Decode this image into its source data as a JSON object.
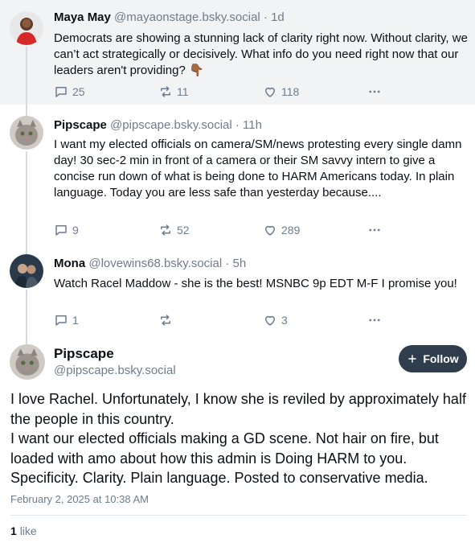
{
  "posts": [
    {
      "name": "Maya May",
      "handle": "@mayaonstage.bsky.social · 1d",
      "text": "Democrats are showing a stunning lack of clarity right now. Without clarity, we can’t act strategically or decisively. What info do you need right now that our leaders aren't providing? 👇🏾",
      "replies": "25",
      "reposts": "11",
      "likes": "118"
    },
    {
      "name": "Pipscape",
      "handle": "@pipscape.bsky.social · 11h",
      "text": "I want my elected officials on camera/SM/news protesting every single damn day! 30 sec-2 min in front of a camera or their SM savvy intern to give a concise run down of what is being done to HARM Americans today. In plain language. Today you are less safe than yesterday because....",
      "replies": "9",
      "reposts": "52",
      "likes": "289"
    },
    {
      "name": "Mona",
      "handle": "@lovewins68.bsky.social · 5h",
      "text": "Watch Racel Maddow - she is the best! MSNBC 9p EDT M-F I promise you!",
      "replies": "1",
      "reposts": "",
      "likes": "3"
    }
  ],
  "main": {
    "name": "Pipscape",
    "handle": "@pipscape.bsky.social",
    "follow_label": "Follow",
    "text": "I love Rachel. Unfortunately, I know she is reviled by approximately half the people in this country.\nI want our elected officials making a GD scene. Not hair on fire, but loaded with amo about how this admin is Doing HARM to you. Specificity. Clarity. Plain language. Posted to conservative media.",
    "date": "February 2, 2025 at 10:38 AM",
    "like_count": "1",
    "like_label": "like"
  },
  "colors": {
    "muted": "#6f7c8b",
    "follow_bg": "#2f3d4d",
    "thread_line": "#d4dbe2"
  }
}
